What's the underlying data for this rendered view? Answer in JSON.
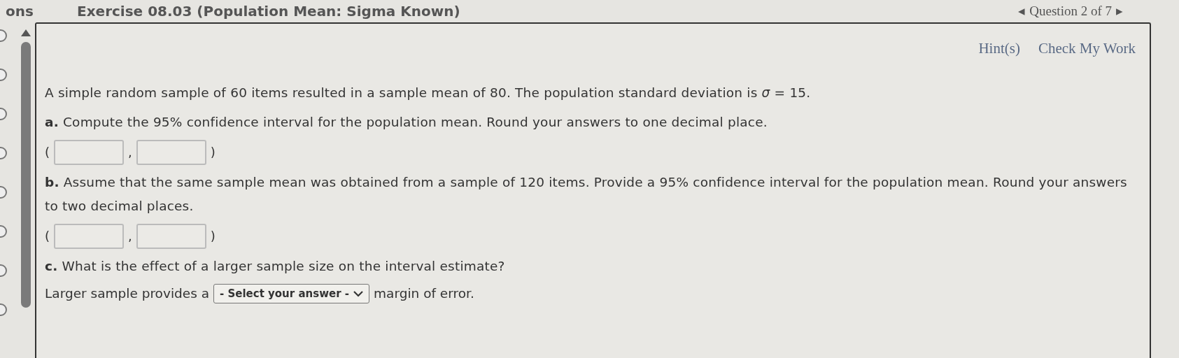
{
  "header": {
    "left_fragment": "ons",
    "title": "Exercise 08.03 (Population Mean: Sigma Known)",
    "question_nav": {
      "prev": "◂",
      "label": "Question 2 of 7",
      "next": "▸"
    }
  },
  "actions": [
    "Hint(s)",
    "Check My Work"
  ],
  "items": [
    {
      "kind": "text",
      "text": "A simple random sample of 60 items resulted in a sample mean of 80. The population standard deviation is *σ* = 15."
    },
    {
      "kind": "text",
      "text": "**a.** Compute the 95% confidence interval for the population mean. Round your answers to one decimal place."
    },
    {
      "kind": "interval",
      "open": "(",
      "separator": ",",
      "close": ")"
    },
    {
      "kind": "text",
      "text": "**b.** Assume that the same sample mean was obtained from a sample of 120 items. Provide a 95% confidence interval for the population mean. Round your answers to two decimal places."
    },
    {
      "kind": "interval",
      "open": "(",
      "separator": ",",
      "close": ")"
    },
    {
      "kind": "text",
      "text": "**c.** What is the effect of a larger sample size on the interval estimate?"
    },
    {
      "kind": "select",
      "before": "Larger sample provides a",
      "value": "- Select your answer -",
      "after": "margin of error."
    }
  ]
}
